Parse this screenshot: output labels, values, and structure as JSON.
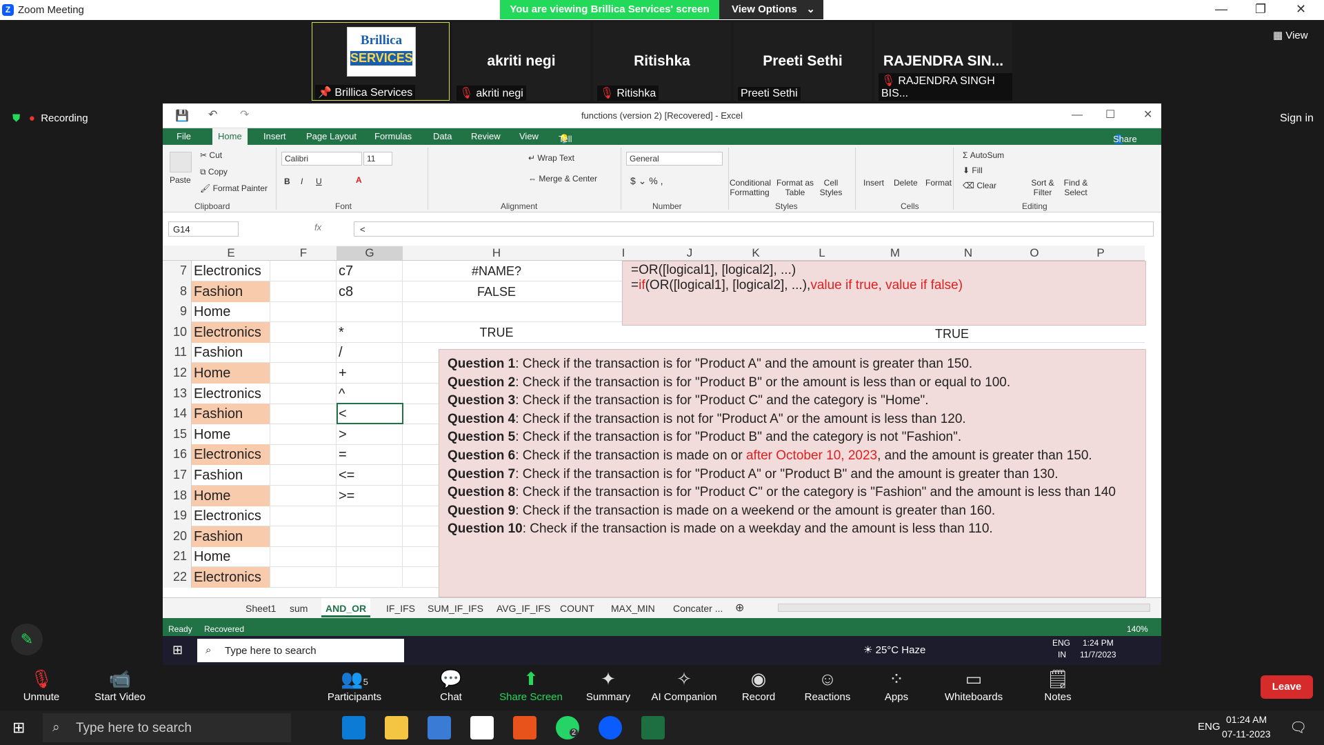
{
  "zoom": {
    "title": "Zoom Meeting",
    "banner": "You are viewing Brillica Services' screen",
    "view_options": "View Options",
    "view": "View",
    "recording": "Recording",
    "sign_in": "Sign in",
    "leave": "Leave",
    "participants": [
      {
        "name": "",
        "label": "Brillica Services",
        "logo_top": "Brillica",
        "logo_bottom": "SERVICES"
      },
      {
        "name": "akriti negi",
        "label": "akriti negi"
      },
      {
        "name": "Ritishka",
        "label": "Ritishka"
      },
      {
        "name": "Preeti Sethi",
        "label": "Preeti Sethi"
      },
      {
        "name": "RAJENDRA  SIN...",
        "label": "RAJENDRA SINGH BIS..."
      }
    ],
    "toolbar": {
      "unmute": "Unmute",
      "start_video": "Start Video",
      "participants": "Participants",
      "participants_count": "5",
      "chat": "Chat",
      "share": "Share Screen",
      "summary": "Summary",
      "ai": "AI Companion",
      "record": "Record",
      "reactions": "Reactions",
      "apps": "Apps",
      "whiteboards": "Whiteboards",
      "notes": "Notes"
    }
  },
  "excel": {
    "title": "functions (version 2) [Recovered] - Excel",
    "tabs": [
      "File",
      "Home",
      "Insert",
      "Page Layout",
      "Formulas",
      "Data",
      "Review",
      "View"
    ],
    "tell_me": "Tell me what you want to do...",
    "share": "Share",
    "ribbon": {
      "paste": "Paste",
      "cut": "Cut",
      "copy": "Copy",
      "format_painter": "Format Painter",
      "clipboard": "Clipboard",
      "font_name": "Calibri",
      "font_size": "11",
      "font": "Font",
      "wrap": "Wrap Text",
      "merge": "Merge & Center",
      "alignment": "Alignment",
      "number_format": "General",
      "number": "Number",
      "cond": "Conditional Formatting",
      "fmt_table": "Format as Table",
      "cell_styles": "Cell Styles",
      "styles": "Styles",
      "insert": "Insert",
      "delete": "Delete",
      "format": "Format",
      "cells": "Cells",
      "autosum": "AutoSum",
      "fill": "Fill",
      "clear": "Clear",
      "sort": "Sort & Filter",
      "find": "Find & Select",
      "editing": "Editing"
    },
    "name_box": "G14",
    "formula": "<",
    "columns": [
      "E",
      "F",
      "G",
      "H",
      "I",
      "J",
      "K",
      "L",
      "M",
      "N",
      "O",
      "P"
    ],
    "rows": [
      {
        "n": "7",
        "e": "Electronics",
        "g": "c7",
        "h": "#NAME?"
      },
      {
        "n": "8",
        "e": "Fashion",
        "g": "c8",
        "h": "FALSE"
      },
      {
        "n": "9",
        "e": "Home",
        "g": "",
        "h": ""
      },
      {
        "n": "10",
        "e": "Electronics",
        "g": "*",
        "h": "TRUE"
      },
      {
        "n": "11",
        "e": "Fashion",
        "g": "/",
        "h": ""
      },
      {
        "n": "12",
        "e": "Home",
        "g": "+",
        "h": ""
      },
      {
        "n": "13",
        "e": "Electronics",
        "g": "^",
        "h": ""
      },
      {
        "n": "14",
        "e": "Fashion",
        "g": "<",
        "h": ""
      },
      {
        "n": "15",
        "e": "Home",
        "g": ">",
        "h": ""
      },
      {
        "n": "16",
        "e": "Electronics",
        "g": "=",
        "h": ""
      },
      {
        "n": "17",
        "e": "Fashion",
        "g": "<=",
        "h": ""
      },
      {
        "n": "18",
        "e": "Home",
        "g": ">=",
        "h": ""
      },
      {
        "n": "19",
        "e": "Electronics",
        "g": "",
        "h": ""
      },
      {
        "n": "20",
        "e": "Fashion",
        "g": "",
        "h": ""
      },
      {
        "n": "21",
        "e": "Home",
        "g": "",
        "h": ""
      },
      {
        "n": "22",
        "e": "Electronics",
        "g": "",
        "h": ""
      }
    ],
    "n10": "TRUE",
    "formula_box": {
      "line1": "=OR([logical1], [logical2], ...)",
      "line2_a": "=",
      "line2_if": "if",
      "line2_b": "(OR([logical1], [logical2], ...),",
      "line2_red": "value if true, value if false)"
    },
    "questions": [
      {
        "q": "Question 1",
        "t": ": Check if the transaction is for \"Product A\" and the amount is greater than 150."
      },
      {
        "q": "Question 2",
        "t": ": Check if the transaction is for \"Product B\" or the amount is less than or equal to 100."
      },
      {
        "q": "Question 3",
        "t": ": Check if the transaction is for \"Product C\" and the category is \"Home\"."
      },
      {
        "q": "Question 4",
        "t": ": Check if the transaction is not for \"Product A\" or the amount is less than 120."
      },
      {
        "q": "Question 5",
        "t": ": Check if the transaction is for \"Product B\" and the category is not \"Fashion\"."
      },
      {
        "q": "Question 6",
        "t": ": Check if the transaction is made on or ",
        "red": "after October 10, 2023",
        "t2": ", and the amount is greater than 150."
      },
      {
        "q": "Question 7",
        "t": ": Check if the transaction is for \"Product A\" or \"Product B\" and the amount is greater than 130."
      },
      {
        "q": "Question 8",
        "t": ": Check if the transaction is for \"Product C\" or the category is \"Fashion\" and the amount is less than 140"
      },
      {
        "q": "Question 9",
        "t": ": Check if the transaction is made on a weekend or the amount is greater than 160."
      },
      {
        "q": "Question 10",
        "t": ": Check if the transaction is made on a weekday and the amount is less than 110."
      }
    ],
    "sheets": [
      "Sheet1",
      "sum",
      "AND_OR",
      "IF_IFS",
      "SUM_IF_IFS",
      "AVG_IF_IFS",
      "COUNT",
      "MAX_MIN",
      "Concater ..."
    ],
    "status_ready": "Ready",
    "status_recovered": "Recovered",
    "zoom": "140%"
  },
  "inner_taskbar": {
    "search": "Type here to search",
    "weather": "25°C  Haze",
    "lang": "ENG",
    "region": "IN",
    "time": "1:24 PM",
    "date": "11/7/2023"
  },
  "outer_taskbar": {
    "search": "Type here to search",
    "lang": "ENG",
    "time": "01:24 AM",
    "date": "07-11-2023",
    "whatsapp_badge": "2"
  }
}
